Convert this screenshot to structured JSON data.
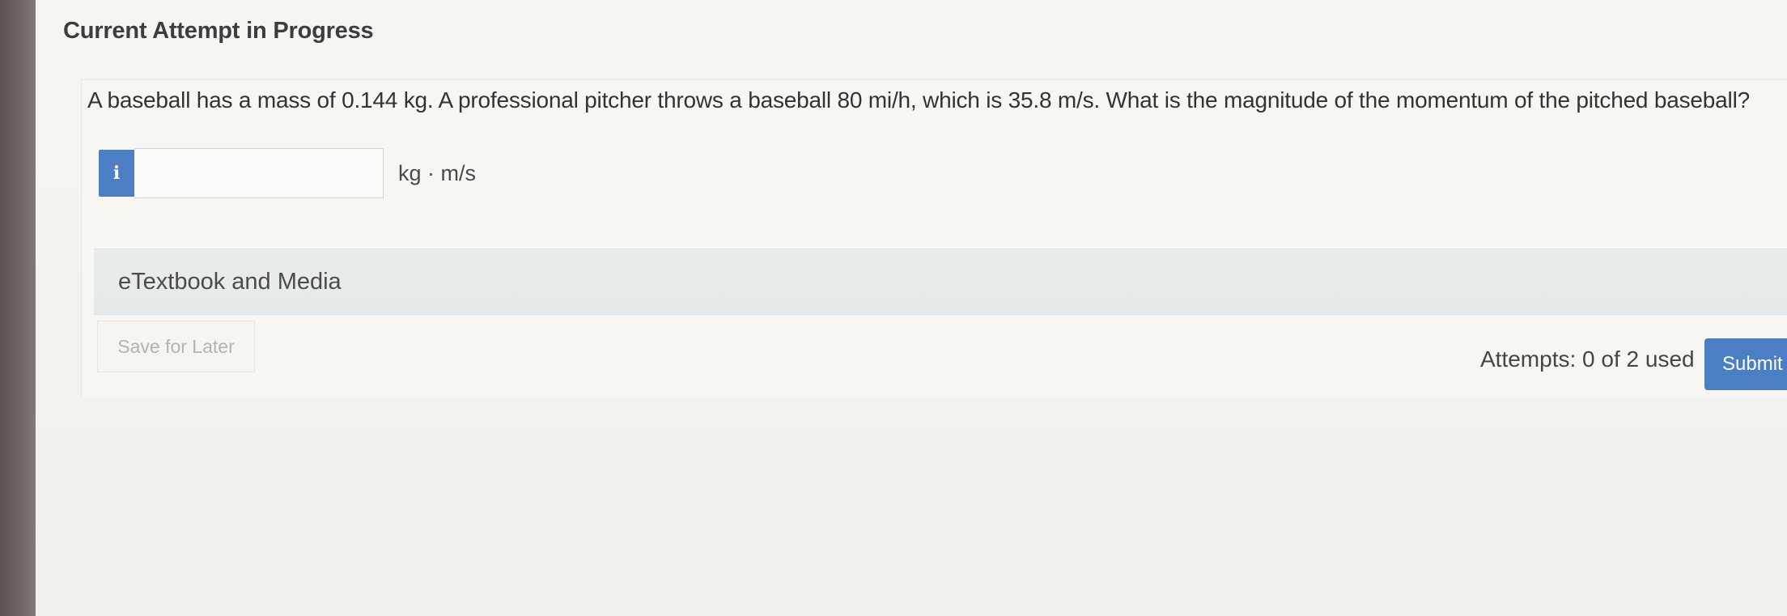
{
  "header": {
    "title": "Current Attempt in Progress"
  },
  "question": {
    "text": "A baseball has a mass of 0.144 kg. A professional pitcher throws a baseball 80 mi/h, which is 35.8 m/s. What is the magnitude of the momentum of the pitched baseball?",
    "info_icon": "i",
    "answer_value": "",
    "unit": "kg · m/s"
  },
  "resources": {
    "label": "eTextbook and Media"
  },
  "footer": {
    "save_label": "Save for Later",
    "attempts_text": "Attempts: 0 of 2 used",
    "submit_label": "Submit"
  },
  "colors": {
    "accent": "#4a7fc4",
    "panel_bar": "#e7eaea"
  }
}
